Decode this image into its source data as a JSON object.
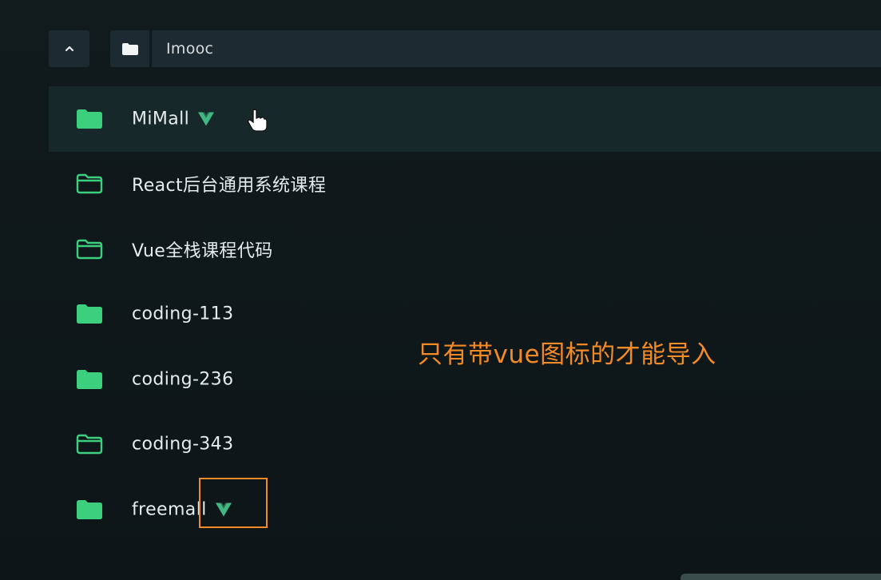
{
  "path_bar": {
    "current_folder": "Imooc",
    "up_icon": "chevron-up-icon",
    "folder_icon": "folder-icon"
  },
  "folders": [
    {
      "name": "MiMall",
      "has_vue": true,
      "selected": true,
      "filled": true
    },
    {
      "name": "React后台通用系统课程",
      "has_vue": false,
      "selected": false,
      "filled": false
    },
    {
      "name": "Vue全栈课程代码",
      "has_vue": false,
      "selected": false,
      "filled": false
    },
    {
      "name": "coding-113",
      "has_vue": false,
      "selected": false,
      "filled": true
    },
    {
      "name": "coding-236",
      "has_vue": false,
      "selected": false,
      "filled": true
    },
    {
      "name": "coding-343",
      "has_vue": false,
      "selected": false,
      "filled": false
    },
    {
      "name": "freemall",
      "has_vue": true,
      "selected": false,
      "filled": true
    }
  ],
  "annotation": {
    "text": "只有带vue图标的才能导入"
  },
  "colors": {
    "folder_green": "#3ccf7e",
    "vue_green": "#41b883",
    "annotation_orange": "#f28a26",
    "selected_row": "#17282a",
    "bar_bg": "#1d2a31"
  }
}
